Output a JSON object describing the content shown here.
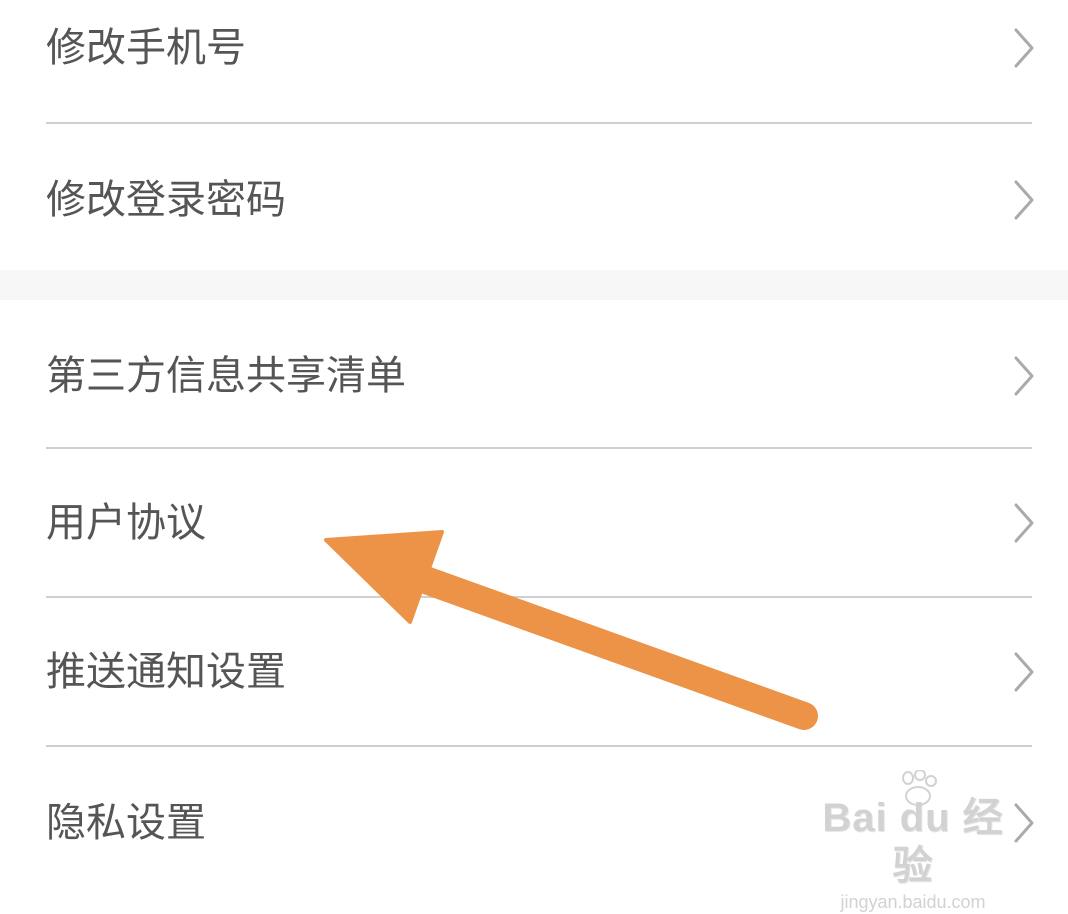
{
  "settings": {
    "items": [
      {
        "label": "修改手机号",
        "icon": "chevron-right-icon"
      },
      {
        "label": "修改登录密码",
        "icon": "chevron-right-icon"
      },
      {
        "label": "第三方信息共享清单",
        "icon": "chevron-right-icon"
      },
      {
        "label": "用户协议",
        "icon": "chevron-right-icon"
      },
      {
        "label": "推送通知设置",
        "icon": "chevron-right-icon"
      },
      {
        "label": "隐私设置",
        "icon": "chevron-right-icon"
      }
    ]
  },
  "annotation": {
    "arrow_color": "#ec9347",
    "points_to": "用户协议"
  },
  "watermark": {
    "logo": "Bai du 经验",
    "url": "jingyan.baidu.com"
  },
  "colors": {
    "text": "#555555",
    "divider": "#cfcfcf",
    "section_gap": "#f7f7f7",
    "chevron": "#aaaaaa"
  }
}
